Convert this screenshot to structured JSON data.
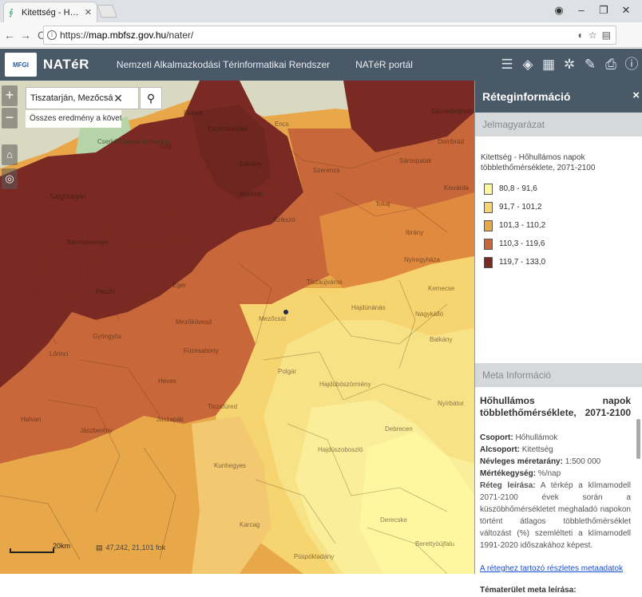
{
  "browser": {
    "tab_title": "Kitettség - Hőhullámos n",
    "url_scheme": "https://",
    "url_host": "map.mbfsz.gov.hu",
    "url_path": "/nater/"
  },
  "app": {
    "logo_text": "MFGI",
    "brand": "NATéR",
    "nav": [
      "Nemzeti Alkalmazkodási Térinformatikai Rendszer",
      "NATéR portál"
    ]
  },
  "search": {
    "value": "Tiszatarján, Mezőcsáti Járá",
    "all_results": "Összes eredmény a követke..."
  },
  "map": {
    "scale_label": "20km",
    "coords": "47,242, 21,101 fok",
    "colors": [
      "#fff7a0",
      "#f6d570",
      "#e8a84a",
      "#c8683a",
      "#7a2a22"
    ],
    "labels": [
      "Putnok",
      "Salgótarján",
      "Miskolc",
      "Ózd",
      "Szerencs",
      "Eger",
      "Mezőkövesd",
      "Gyöngyös",
      "Füzesabony",
      "Tiszaújváros",
      "Nyíregyháza",
      "Debrecen",
      "Hajdúnánás",
      "Kemecse",
      "Balkány",
      "Sátoraljaújhely",
      "Jászberény",
      "Hatvan",
      "Heves",
      "Kisvárda",
      "Tokaj",
      "Encs",
      "Mezőcsát",
      "Sárospatak",
      "Polgár",
      "Hajdúböszörmény",
      "Hajdúszoboszló",
      "Püspökladány",
      "Berettyóújfalu",
      "Karcag",
      "Tiszafüred",
      "Nagykálló",
      "Dombrád",
      "Kazincbarcika",
      "Szikszó",
      "Edelény",
      "Bátonyterenye",
      "Pásztó",
      "Lőrinci",
      "Jászapáti",
      "Kunhegyes",
      "Derecske",
      "Nyírbátor",
      "Ibrány",
      "Cserkő Cerová vrchovina"
    ]
  },
  "panel": {
    "title": "Réteginformáció",
    "legend_header": "Jelmagyarázat",
    "legend_title": "Kitettség - Hőhullámos napok többlethőmérséklete, 2071-2100",
    "legend": [
      {
        "label": "80,8 - 91,6",
        "color": "#fff7a0"
      },
      {
        "label": "91,7 - 101,2",
        "color": "#f6d570"
      },
      {
        "label": "101,3 - 110,2",
        "color": "#e8a84a"
      },
      {
        "label": "110,3 - 119,6",
        "color": "#c8683a"
      },
      {
        "label": "119,7 - 133,0",
        "color": "#7a2a22"
      }
    ],
    "meta_header": "Meta Információ",
    "meta_title": "Hőhullámos napok többlethőmérséklete, 2071-2100",
    "meta": {
      "group_key": "Csoport:",
      "group_val": "Hőhullámok",
      "subgroup_key": "Alcsoport:",
      "subgroup_val": "Kitettség",
      "scale_key": "Névleges méretarány:",
      "scale_val": "1:500 000",
      "unit_key": "Mértékegység:",
      "unit_val": "%/nap",
      "desc_key": "Réteg leírása:",
      "desc_val": "A térkép a klímamodell 2071-2100 évek során a küszöbhőmérsékletet meghaladó napokon történt átlagos többlethőmérséklet változást (%) szemlélteti a klímamodell 1991-2020 időszakához képest.",
      "link": "A réteghez tartozó részletes metaadatok",
      "last": "Tématerület meta leírása:"
    }
  }
}
